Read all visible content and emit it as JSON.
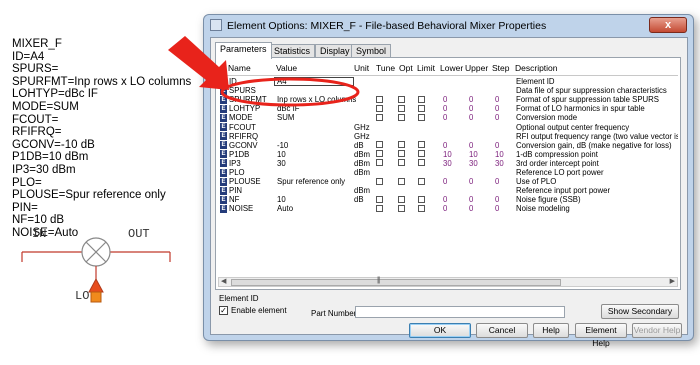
{
  "schematic": {
    "lines": [
      "MIXER_F",
      "ID=A4",
      "SPURS=",
      "SPURFMT=Inp rows x LO columns",
      "LOHTYP=dBc IF",
      "MODE=SUM",
      "FCOUT=",
      "RFIFRQ=",
      "GCONV=-10 dB",
      "P1DB=10 dBm",
      "IP3=30 dBm",
      "PLO=",
      "PLOUSE=Spur reference only",
      "PIN=",
      "NF=10 dB",
      "NOISE=Auto"
    ],
    "port_in": "IN",
    "port_out": "OUT",
    "port_lo": "LO"
  },
  "dialog": {
    "title": "Element Options: MIXER_F - File-based Behavioral Mixer Properties",
    "close_label": "x",
    "tabs": [
      "Parameters",
      "Statistics",
      "Display",
      "Symbol"
    ],
    "columns": [
      "Name",
      "Value",
      "Unit",
      "Tune",
      "Opt",
      "Limit",
      "Lower",
      "Upper",
      "Step",
      "Description"
    ],
    "param_icon": "E",
    "rows": [
      {
        "name": "ID",
        "value": "A4",
        "unit": "",
        "checks": false,
        "lower": "",
        "upper": "",
        "step": "",
        "desc": "Element ID"
      },
      {
        "name": "SPURS",
        "value": "",
        "unit": "",
        "checks": false,
        "lower": "",
        "upper": "",
        "step": "",
        "desc": "Data file of spur suppression characteristics"
      },
      {
        "name": "SPURFMT",
        "value": "Inp rows x LO columns",
        "unit": "",
        "checks": true,
        "lower": "0",
        "upper": "0",
        "step": "0",
        "desc": "Format of spur suppression table SPURS"
      },
      {
        "name": "LOHTYP",
        "value": "dBc IF",
        "unit": "",
        "checks": true,
        "lower": "0",
        "upper": "0",
        "step": "0",
        "desc": "Format of LO harmonics in spur table"
      },
      {
        "name": "MODE",
        "value": "SUM",
        "unit": "",
        "checks": true,
        "lower": "0",
        "upper": "0",
        "step": "0",
        "desc": "Conversion mode"
      },
      {
        "name": "FCOUT",
        "value": "",
        "unit": "GHz",
        "checks": false,
        "lower": "",
        "upper": "",
        "step": "",
        "desc": "Optional output center frequency"
      },
      {
        "name": "RFIFRQ",
        "value": "",
        "unit": "GHz",
        "checks": false,
        "lower": "",
        "upper": "",
        "step": "",
        "desc": "RFI output frequency range (two value vector is a"
      },
      {
        "name": "GCONV",
        "value": "-10",
        "unit": "dB",
        "checks": true,
        "lower": "0",
        "upper": "0",
        "step": "0",
        "desc": "Conversion gain, dB (make negative for loss)"
      },
      {
        "name": "P1DB",
        "value": "10",
        "unit": "dBm",
        "checks": true,
        "lower": "10",
        "upper": "10",
        "step": "10",
        "desc": "1-dB compression point"
      },
      {
        "name": "IP3",
        "value": "30",
        "unit": "dBm",
        "checks": true,
        "lower": "30",
        "upper": "30",
        "step": "30",
        "desc": "3rd order intercept point"
      },
      {
        "name": "PLO",
        "value": "",
        "unit": "dBm",
        "checks": false,
        "lower": "",
        "upper": "",
        "step": "",
        "desc": "Reference LO port power"
      },
      {
        "name": "PLOUSE",
        "value": "Spur reference only",
        "unit": "",
        "checks": true,
        "lower": "0",
        "upper": "0",
        "step": "0",
        "desc": "Use of PLO"
      },
      {
        "name": "PIN",
        "value": "",
        "unit": "dBm",
        "checks": false,
        "lower": "",
        "upper": "",
        "step": "",
        "desc": "Reference input port power"
      },
      {
        "name": "NF",
        "value": "10",
        "unit": "dB",
        "checks": true,
        "lower": "0",
        "upper": "0",
        "step": "0",
        "desc": "Noise figure (SSB)"
      },
      {
        "name": "NOISE",
        "value": "Auto",
        "unit": "",
        "checks": true,
        "lower": "0",
        "upper": "0",
        "step": "0",
        "desc": "Noise modeling"
      }
    ],
    "element_id_label": "Element ID",
    "enable_label": "Enable element",
    "part_number_label": "Part Number",
    "buttons": {
      "show_secondary": "Show Secondary",
      "ok": "OK",
      "cancel": "Cancel",
      "help": "Help",
      "element_help": "Element Help",
      "vendor_help": "Vendor Help"
    }
  },
  "colors": {
    "highlight": "#e8231b",
    "accent": "#243b7a"
  }
}
